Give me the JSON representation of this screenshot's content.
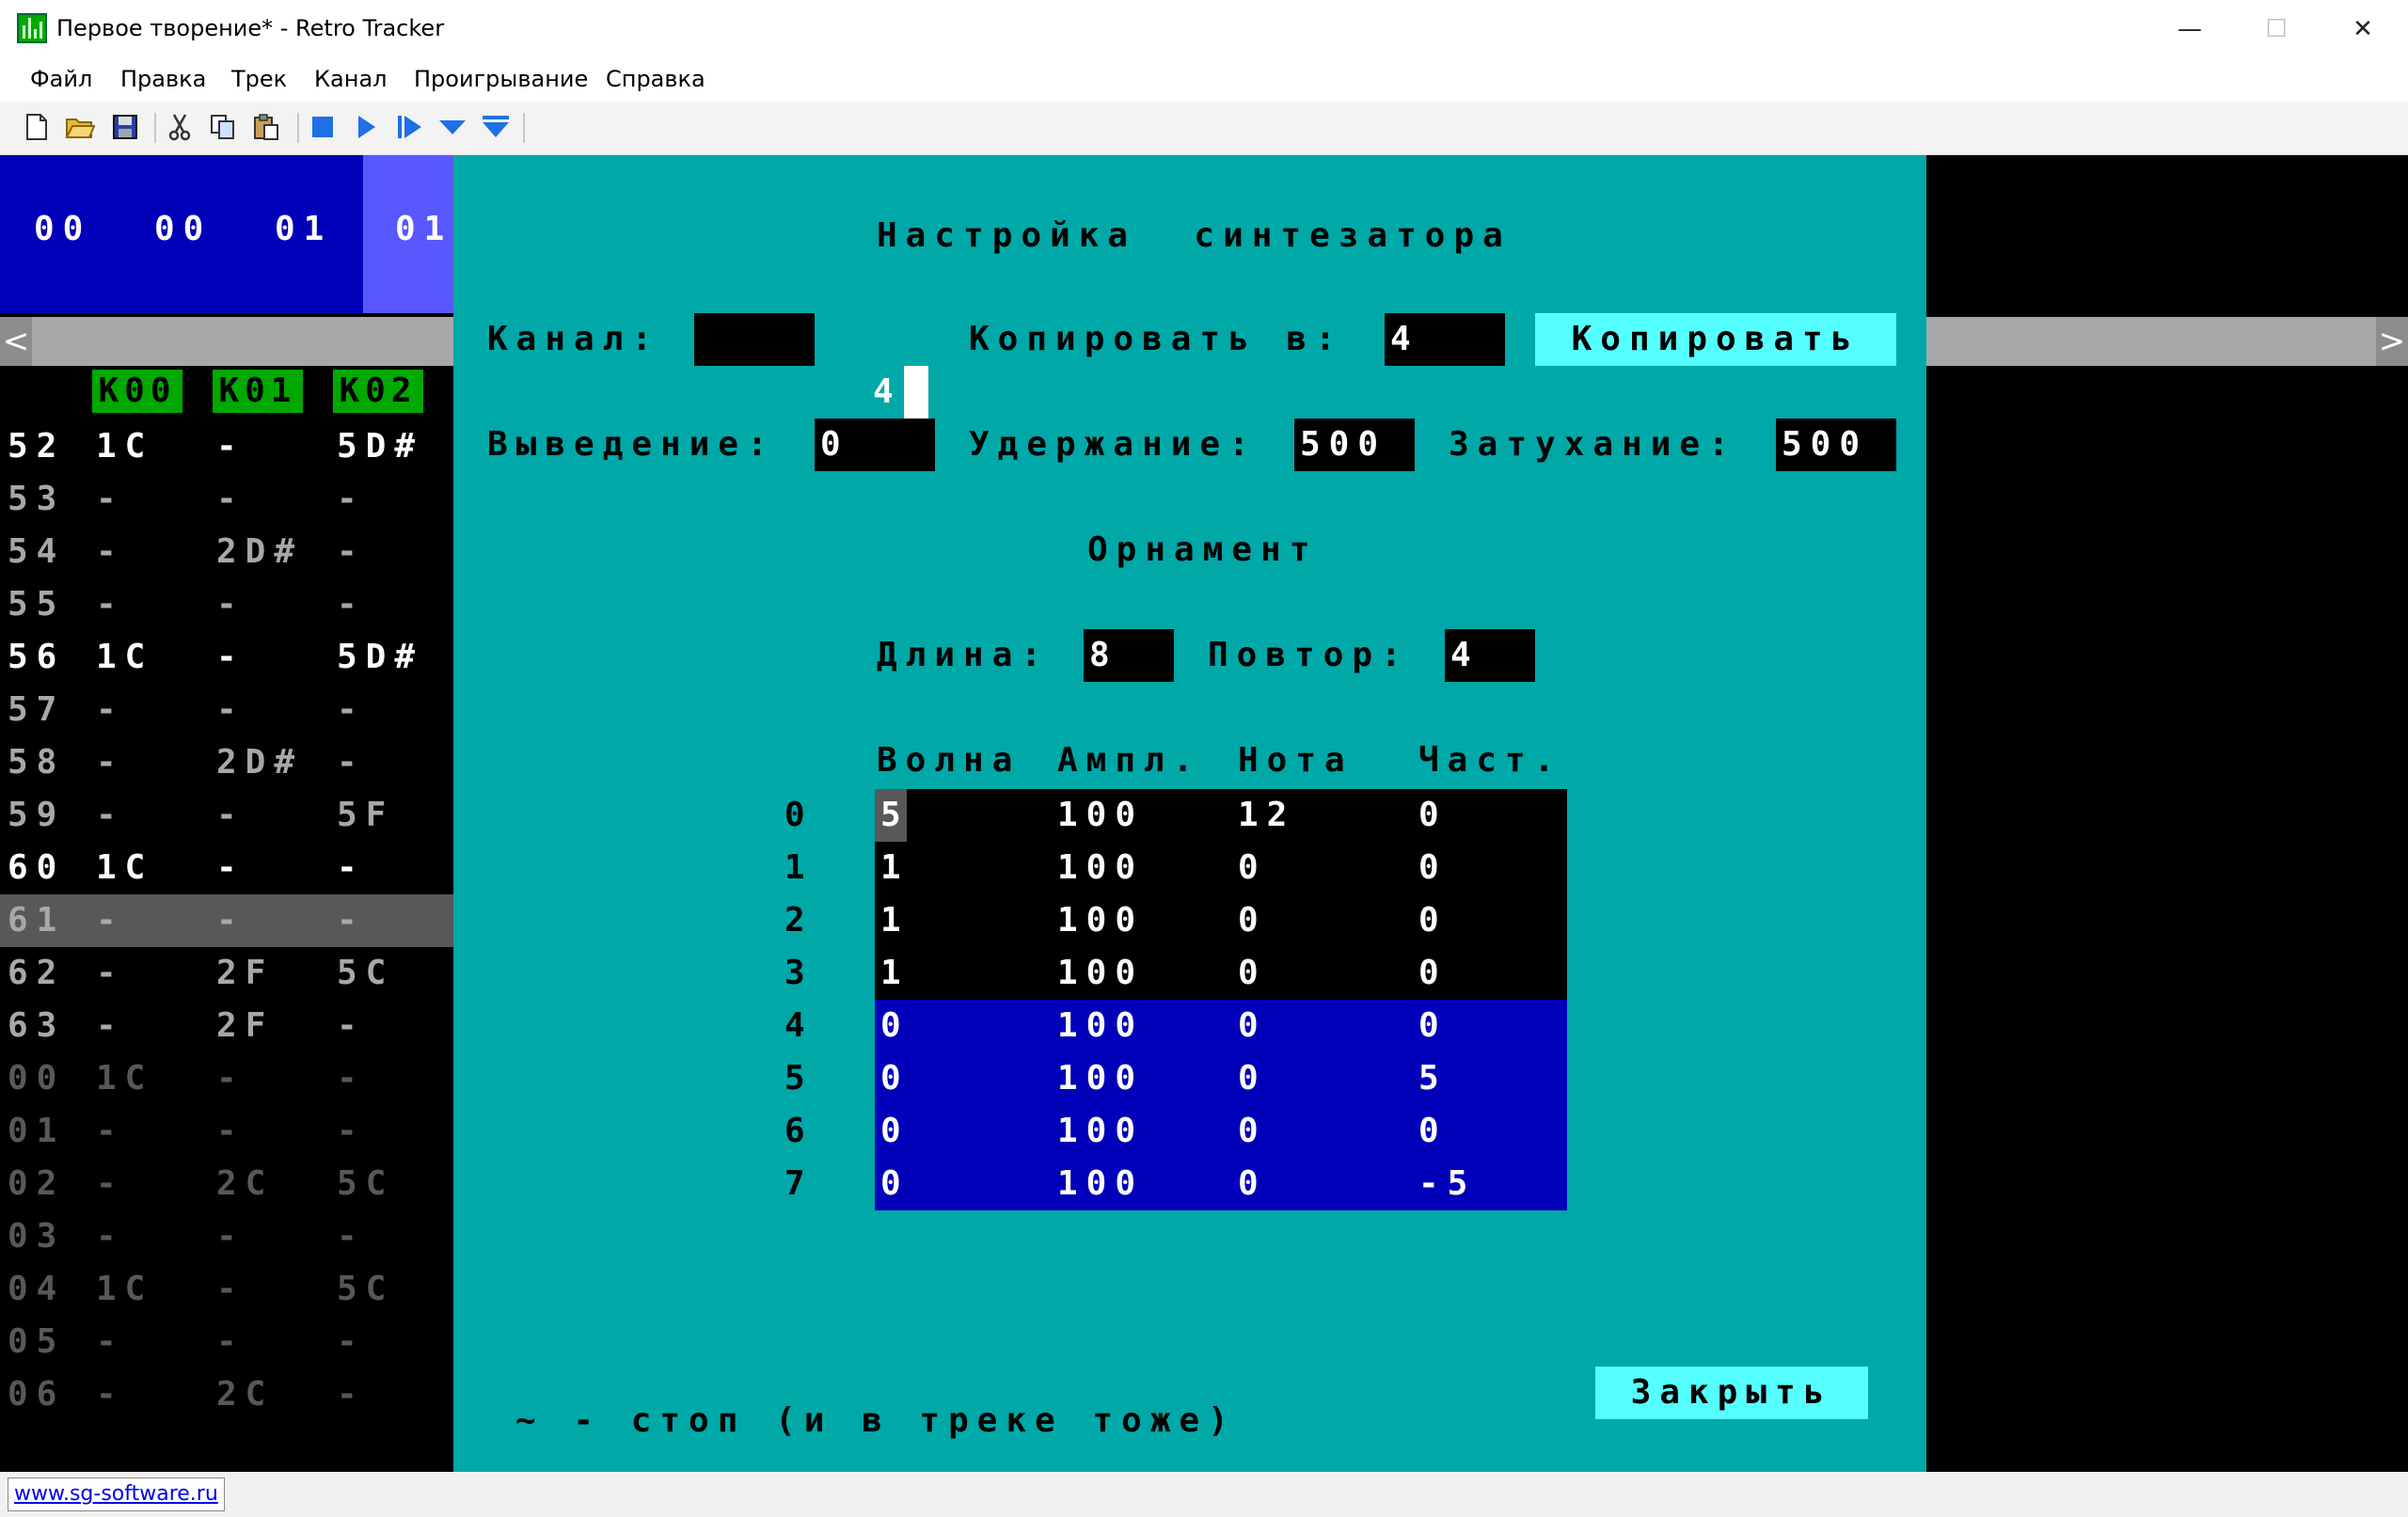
{
  "window": {
    "title": "Первое творение* - Retro Tracker",
    "minimize": "—",
    "maximize": "☐",
    "close": "✕"
  },
  "menu": [
    "Файл",
    "Правка",
    "Трек",
    "Канал",
    "Проигрывание",
    "Справка"
  ],
  "toolbar_icons": [
    "new-file-icon",
    "open-folder-icon",
    "save-icon",
    "cut-icon",
    "copy-icon",
    "paste-icon",
    "stop-icon",
    "play-icon",
    "play-from-cursor-icon",
    "step-down-icon",
    "step-down-end-icon"
  ],
  "orders": [
    "00",
    "00",
    "01",
    "01"
  ],
  "scroll": {
    "left": "<",
    "right": ">"
  },
  "channels": [
    "К00",
    "К01",
    "К02"
  ],
  "pattern_rows": [
    {
      "n": "52",
      "c0": "1C",
      "c1": "-",
      "c2": "5D#",
      "style": "hi"
    },
    {
      "n": "53",
      "c0": "-",
      "c1": "-",
      "c2": "-",
      "style": "lo"
    },
    {
      "n": "54",
      "c0": "-",
      "c1": "2D#",
      "c2": "-",
      "style": "lo"
    },
    {
      "n": "55",
      "c0": "-",
      "c1": "-",
      "c2": "-",
      "style": "lo"
    },
    {
      "n": "56",
      "c0": "1C",
      "c1": "-",
      "c2": "5D#",
      "style": "hi"
    },
    {
      "n": "57",
      "c0": "-",
      "c1": "-",
      "c2": "-",
      "style": "lo"
    },
    {
      "n": "58",
      "c0": "-",
      "c1": "2D#",
      "c2": "-",
      "style": "lo"
    },
    {
      "n": "59",
      "c0": "-",
      "c1": "-",
      "c2": "5F",
      "style": "lo"
    },
    {
      "n": "60",
      "c0": "1C",
      "c1": "-",
      "c2": "-",
      "style": "hi"
    },
    {
      "n": "61",
      "c0": "-",
      "c1": "-",
      "c2": "-",
      "style": "cur"
    },
    {
      "n": "62",
      "c0": "-",
      "c1": "2F",
      "c2": "5C",
      "style": "lo"
    },
    {
      "n": "63",
      "c0": "-",
      "c1": "2F",
      "c2": "-",
      "style": "lo"
    },
    {
      "n": "00",
      "c0": "1C",
      "c1": "-",
      "c2": "-",
      "style": "dim"
    },
    {
      "n": "01",
      "c0": "-",
      "c1": "-",
      "c2": "-",
      "style": "dim"
    },
    {
      "n": "02",
      "c0": "-",
      "c1": "2C",
      "c2": "5C",
      "style": "dim"
    },
    {
      "n": "03",
      "c0": "-",
      "c1": "-",
      "c2": "-",
      "style": "dim"
    },
    {
      "n": "04",
      "c0": "1C",
      "c1": "-",
      "c2": "5C",
      "style": "dim"
    },
    {
      "n": "05",
      "c0": "-",
      "c1": "-",
      "c2": "-",
      "style": "dim"
    },
    {
      "n": "06",
      "c0": "-",
      "c1": "2C",
      "c2": "-",
      "style": "dim"
    }
  ],
  "dialog": {
    "title": "Настройка  синтезатора",
    "channel_label": "Канал:",
    "channel_value": "4",
    "copy_to_label": "Копировать в:",
    "copy_to_value": "4",
    "copy_button": "Копировать",
    "attack_label": "Выведение:",
    "attack_value": "0",
    "sustain_label": "Удержание:",
    "sustain_value": "500",
    "decay_label": "Затухание:",
    "decay_value": "500",
    "ornament_title": "Орнамент",
    "length_label": "Длина:",
    "length_value": "8",
    "repeat_label": "Повтор:",
    "repeat_value": "4",
    "columns": [
      "Волна",
      "Ампл.",
      "Нота",
      "Част."
    ],
    "ornament_rows": [
      {
        "i": "0",
        "wave": "5",
        "amp": "100",
        "note": "12",
        "freq": "0"
      },
      {
        "i": "1",
        "wave": "1",
        "amp": "100",
        "note": "0",
        "freq": "0"
      },
      {
        "i": "2",
        "wave": "1",
        "amp": "100",
        "note": "0",
        "freq": "0"
      },
      {
        "i": "3",
        "wave": "1",
        "amp": "100",
        "note": "0",
        "freq": "0"
      },
      {
        "i": "4",
        "wave": "0",
        "amp": "100",
        "note": "0",
        "freq": "0"
      },
      {
        "i": "5",
        "wave": "0",
        "amp": "100",
        "note": "0",
        "freq": "5"
      },
      {
        "i": "6",
        "wave": "0",
        "amp": "100",
        "note": "0",
        "freq": "0"
      },
      {
        "i": "7",
        "wave": "0",
        "amp": "100",
        "note": "0",
        "freq": "-5"
      }
    ],
    "footer_hint": "~ - стоп (и в треке тоже)",
    "close_button": "Закрыть"
  },
  "status": {
    "link": "www.sg-software.ru"
  },
  "colors": {
    "dialog_bg": "#00a8a8",
    "order_bg": "#0000b8",
    "channel_header": "#00a800",
    "button": "#55ffff",
    "ornament_loop": "#0000b8"
  }
}
